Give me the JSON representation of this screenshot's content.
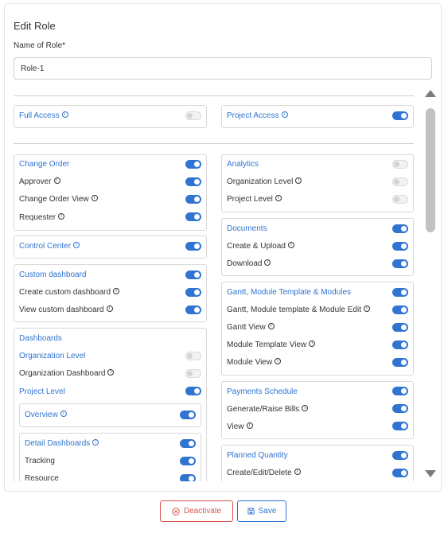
{
  "form": {
    "title": "Edit Role",
    "name_label": "Name of Role*",
    "name_value": "Role-1"
  },
  "access": {
    "full_access": {
      "label": "Full Access",
      "enabled": false
    },
    "project_access": {
      "label": "Project Access",
      "enabled": true
    }
  },
  "left_column": {
    "change_order": {
      "title": "Change Order",
      "items": [
        "Approver",
        "Change Order View",
        "Requester"
      ]
    },
    "control_center": {
      "title": "Control Center"
    },
    "custom_dashboard": {
      "title": "Custom dashboard",
      "items": [
        "Create custom dashboard",
        "View custom dashboard"
      ]
    },
    "dashboards": {
      "title": "Dashboards",
      "items": [
        "Organization Level",
        "Organization Dashboard",
        "Project Level"
      ],
      "overview": "Overview",
      "detail": {
        "title": "Detail Dashboards",
        "items": [
          "Tracking",
          "Resource"
        ]
      }
    }
  },
  "right_column": {
    "analytics": {
      "title": "Analytics",
      "items": [
        "Organization Level",
        "Project Level"
      ]
    },
    "documents": {
      "title": "Documents",
      "items": [
        "Create & Upload",
        "Download"
      ]
    },
    "gantt": {
      "title": "Gantt, Module Template & Modules",
      "items": [
        "Gantt, Module template & Module Edit",
        "Gantt View",
        "Module Template View",
        "Module View"
      ]
    },
    "payments": {
      "title": "Payments Schedule",
      "items": [
        "Generate/Raise Bills",
        "View"
      ]
    },
    "planned_quantity": {
      "title": "Planned Quantity",
      "items": [
        "Create/Edit/Delete"
      ]
    }
  },
  "buttons": {
    "deactivate": "Deactivate",
    "save": "Save"
  },
  "colors": {
    "accent": "#2f74d0",
    "danger": "#d9534f",
    "toggle_off": "#f2f2f2"
  },
  "icons": [
    "info-icon",
    "scroll-up-icon",
    "scroll-down-icon",
    "deactivate-icon",
    "save-icon"
  ]
}
